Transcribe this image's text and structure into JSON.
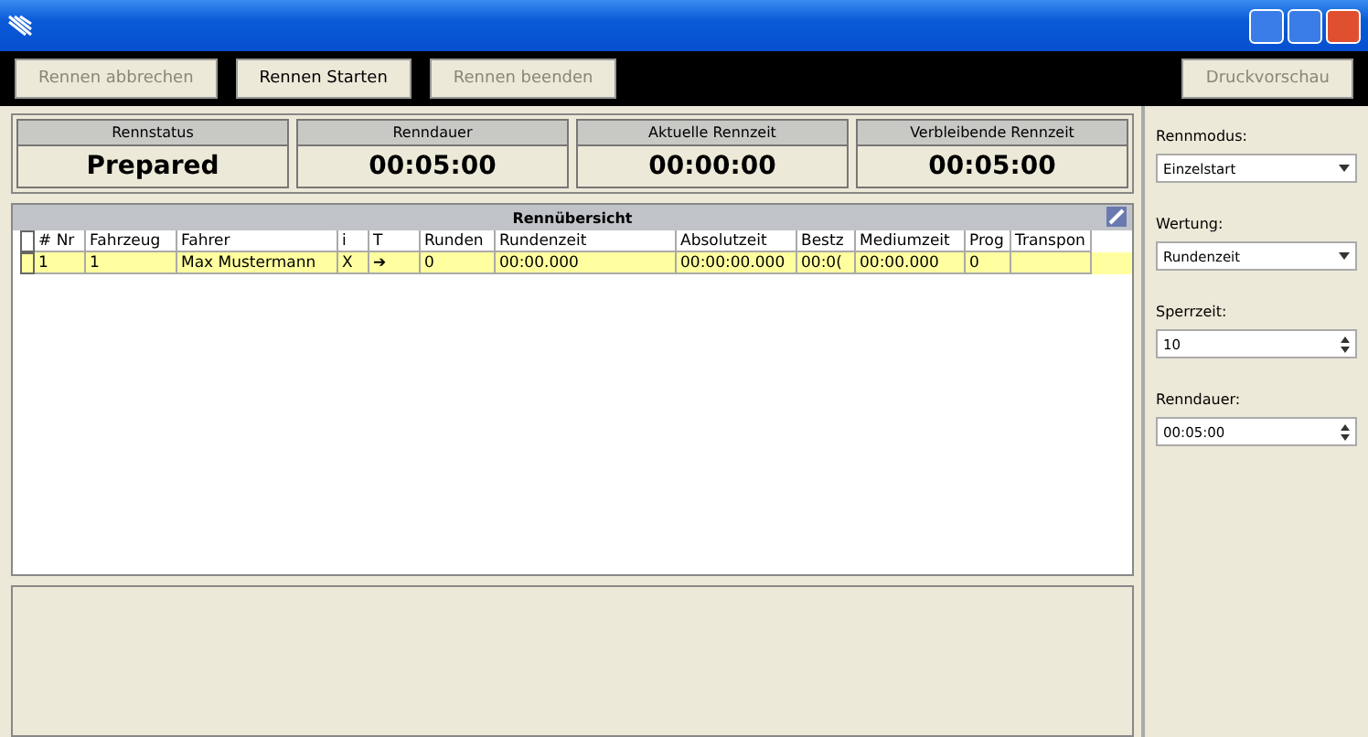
{
  "toolbar": {
    "buttons": [
      {
        "label": "Rennen abbrechen",
        "disabled": true
      },
      {
        "label": "Rennen Starten",
        "disabled": false
      },
      {
        "label": "Rennen beenden",
        "disabled": true
      }
    ],
    "right_button": {
      "label": "Druckvorschau",
      "disabled": true
    }
  },
  "status_cards": [
    {
      "label": "Rennstatus",
      "value": "Prepared"
    },
    {
      "label": "Renndauer",
      "value": "00:05:00"
    },
    {
      "label": "Aktuelle Rennzeit",
      "value": "00:00:00"
    },
    {
      "label": "Verbleibende Rennzeit",
      "value": "00:05:00"
    }
  ],
  "table": {
    "title": "Rennübersicht",
    "columns": [
      "# Nr",
      "Fahrzeug",
      "Fahrer",
      "i",
      "T",
      "Runden",
      "Rundenzeit",
      "Absolutzeit",
      "Bestz",
      "Mediumzeit",
      "Prog",
      "Transpon"
    ],
    "rows": [
      {
        "selected": true,
        "cells": [
          "1",
          "1",
          "Max Mustermann",
          "X",
          "➔",
          "0",
          "00:00.000",
          "00:00:00.000",
          "00:0(",
          "00:00.000",
          "0",
          ""
        ]
      }
    ]
  },
  "settings": [
    {
      "kind": "dropdown",
      "label": "Rennmodus:",
      "value": "Einzelstart"
    },
    {
      "kind": "dropdown",
      "label": "Wertung:",
      "value": "Rundenzeit"
    },
    {
      "kind": "spinner",
      "label": "Sperrzeit:",
      "value": "10"
    },
    {
      "kind": "spinner",
      "label": "Renndauer:",
      "value": "00:05:00"
    }
  ]
}
